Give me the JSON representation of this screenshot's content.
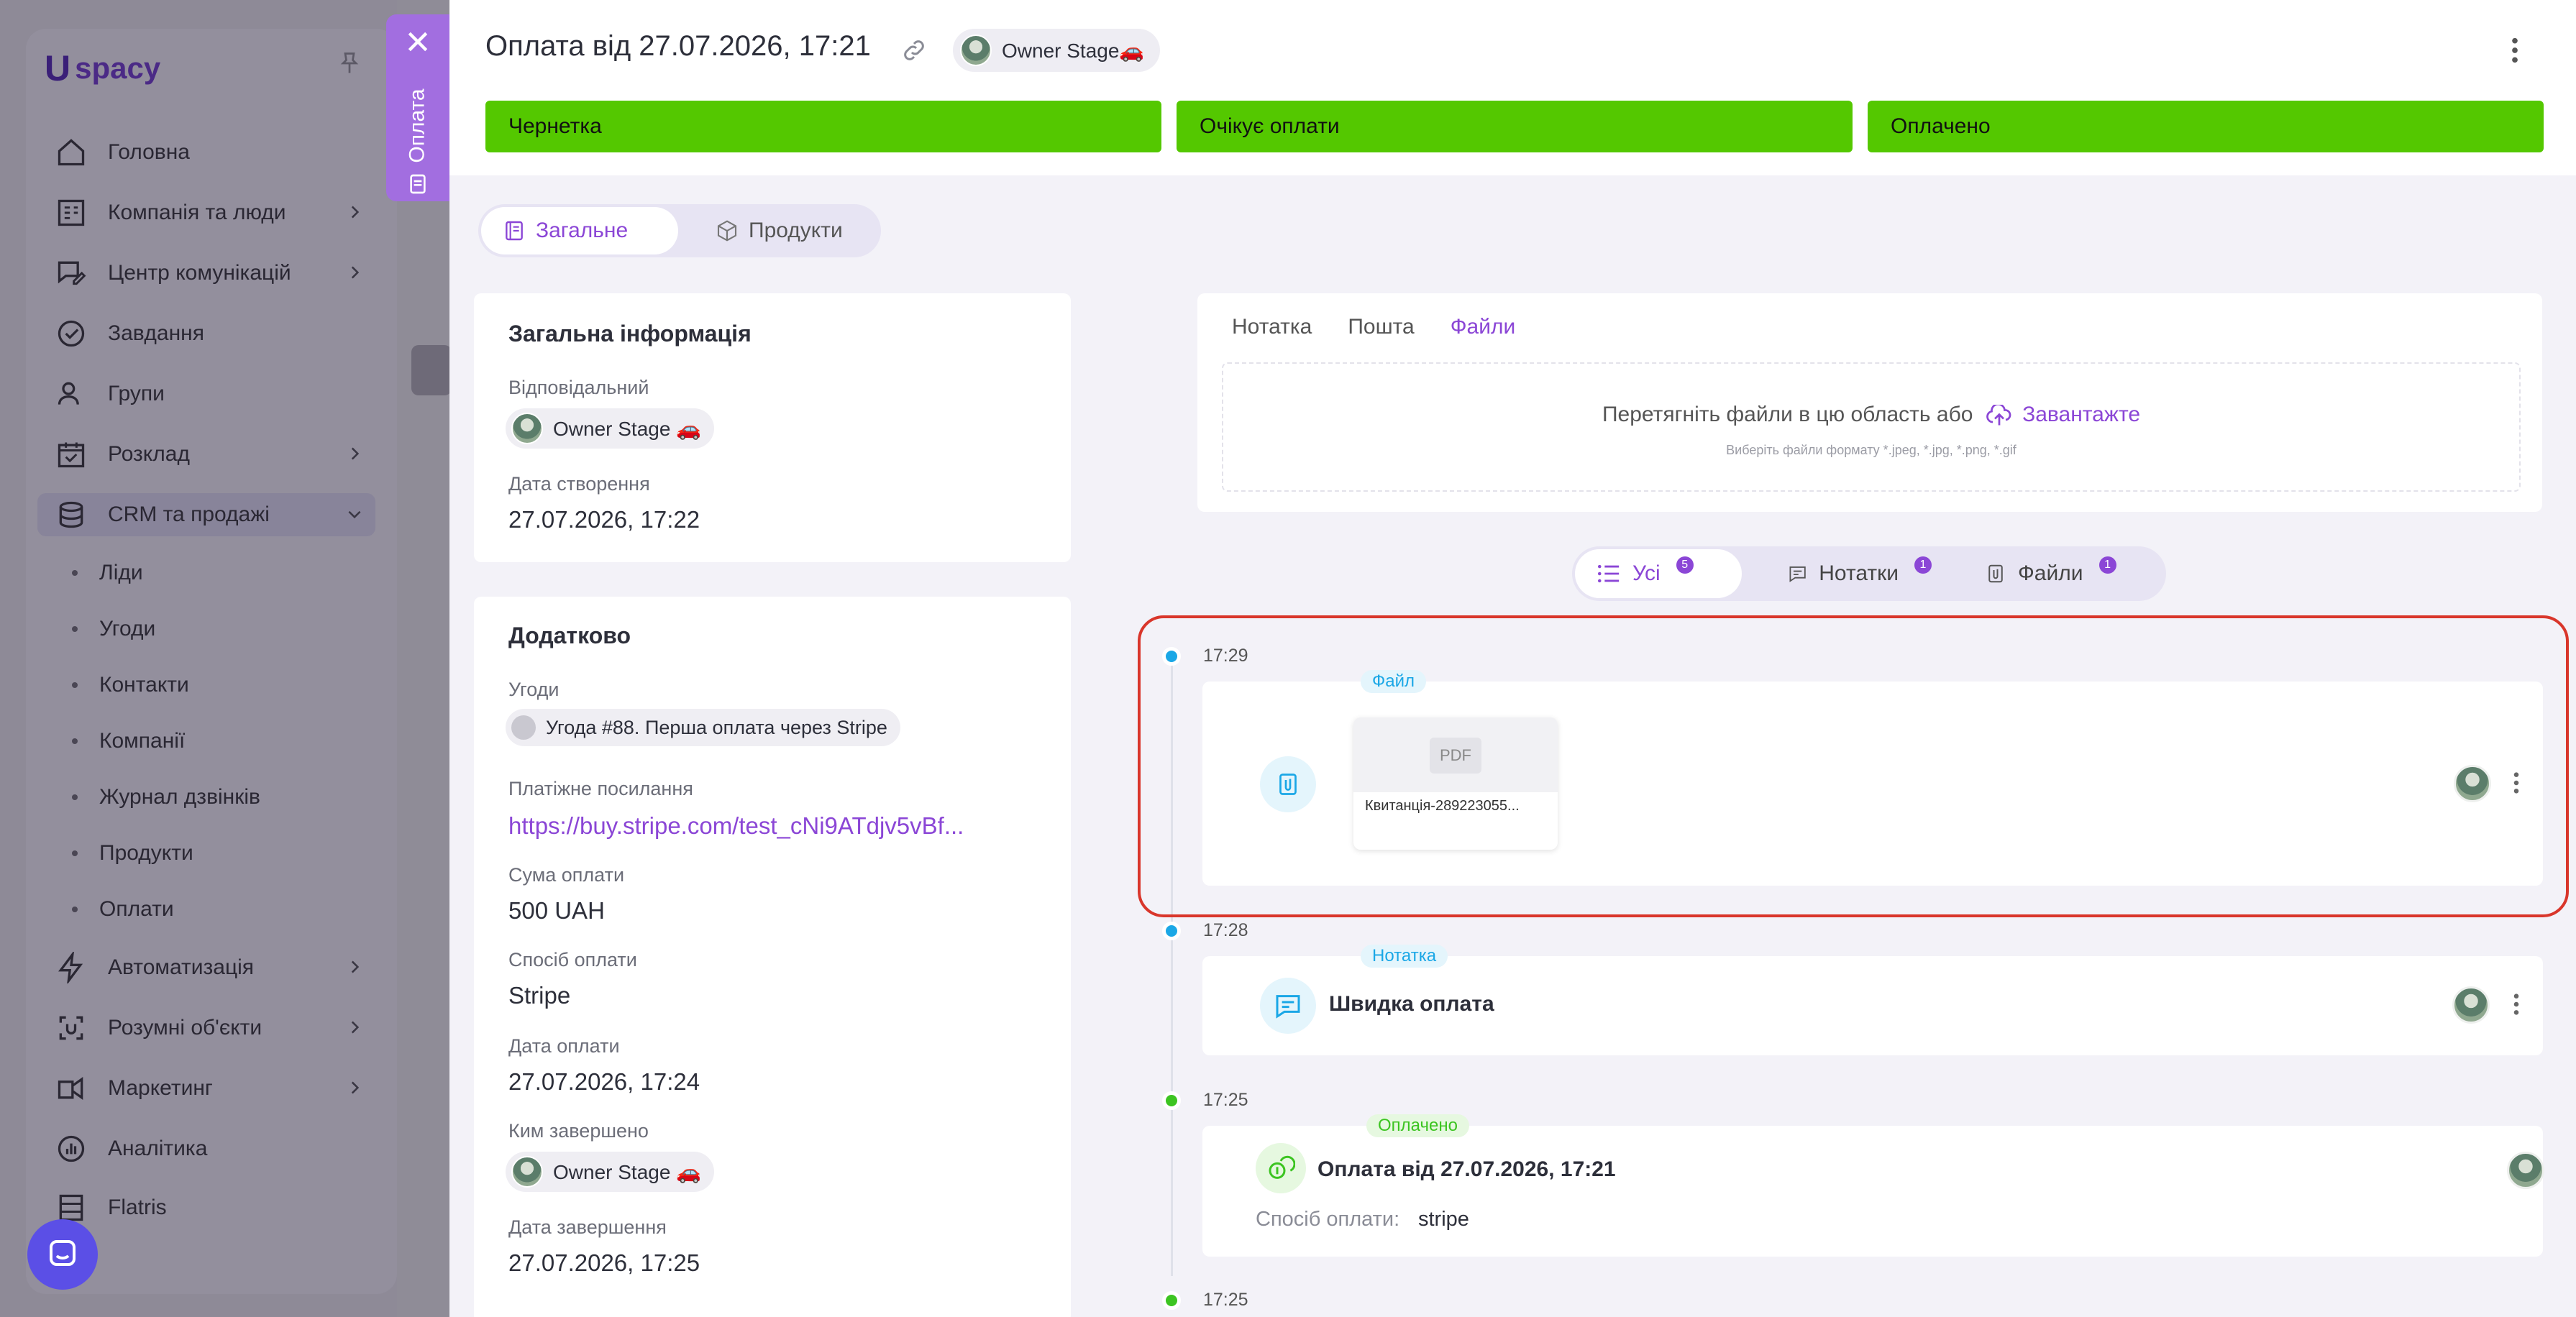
{
  "sidebar": {
    "logo": "spacy",
    "items": [
      {
        "label": "Головна",
        "icon": "home-icon"
      },
      {
        "label": "Компанія та люди",
        "icon": "building-icon"
      },
      {
        "label": "Центр комунікацій",
        "icon": "chat-edit-icon"
      },
      {
        "label": "Завдання",
        "icon": "check-circle-icon"
      },
      {
        "label": "Групи",
        "icon": "people-icon"
      },
      {
        "label": "Розклад",
        "icon": "calendar-icon"
      },
      {
        "label": "CRM та продажі",
        "icon": "database-icon"
      },
      {
        "label": "Автоматизація",
        "icon": "lightning-icon"
      },
      {
        "label": "Розумні об'єкти",
        "icon": "smart-object-icon"
      },
      {
        "label": "Маркетинг",
        "icon": "marketing-icon"
      },
      {
        "label": "Аналітика",
        "icon": "analytics-icon"
      },
      {
        "label": "Flatris",
        "icon": "grid-icon"
      }
    ],
    "crm_sub": [
      "Ліди",
      "Угоди",
      "Контакти",
      "Компанії",
      "Журнал дзвінків",
      "Продукти",
      "Оплати"
    ]
  },
  "side_tab": {
    "label": "Оплата"
  },
  "header": {
    "title": "Оплата від 27.07.2026, 17:21",
    "owner": "Owner Stage🚗",
    "stages": [
      "Чернетка",
      "Очікує оплати",
      "Оплачено"
    ],
    "stage_color": "#54c800"
  },
  "tabs": {
    "general": "Загальне",
    "products": "Продукти"
  },
  "general_info": {
    "title": "Загальна інформація",
    "responsible_label": "Відповідальний",
    "responsible": "Owner Stage 🚗",
    "created_label": "Дата створення",
    "created": "27.07.2026, 17:22"
  },
  "extra": {
    "title": "Додатково",
    "deals_label": "Угоди",
    "deal": "Угода #88. Перша оплата через Stripe",
    "link_label": "Платіжне посилання",
    "link": "https://buy.stripe.com/test_cNi9ATdjv5vBf...",
    "amount_label": "Сума оплати",
    "amount": "500 UAH",
    "method_label": "Спосіб оплати",
    "method": "Stripe",
    "paid_label": "Дата оплати",
    "paid": "27.07.2026, 17:24",
    "completed_by_label": "Ким завершено",
    "completed_by": "Owner Stage 🚗",
    "completed_label": "Дата завершення",
    "completed": "27.07.2026, 17:25"
  },
  "activity": {
    "tabs": [
      "Нотатка",
      "Пошта",
      "Файли"
    ],
    "drop_text": "Перетягніть файли в цю область або",
    "upload": "Завантажте",
    "drop_hint": "Виберіть файли формату *.jpeg, *.jpg, *.png, *.gif"
  },
  "filters": [
    {
      "label": "Усі",
      "count": "5"
    },
    {
      "label": "Нотатки",
      "count": "1"
    },
    {
      "label": "Файли",
      "count": "1"
    }
  ],
  "timeline": [
    {
      "time": "17:29",
      "tag": "Файл",
      "file_type": "PDF",
      "file_name": "Квитанція-289223055..."
    },
    {
      "time": "17:28",
      "tag": "Нотатка",
      "text": "Швидка оплата"
    },
    {
      "time": "17:25",
      "tag": "Оплачено",
      "text": "Оплата від 27.07.2026, 17:21",
      "method_label": "Спосіб оплати:",
      "method": "stripe"
    },
    {
      "time": "17:25"
    }
  ],
  "colors": {
    "accent": "#8b46d6",
    "highlight": "#d9362b",
    "timeline_blue": "#1aa7e6",
    "timeline_green": "#3cc421"
  }
}
